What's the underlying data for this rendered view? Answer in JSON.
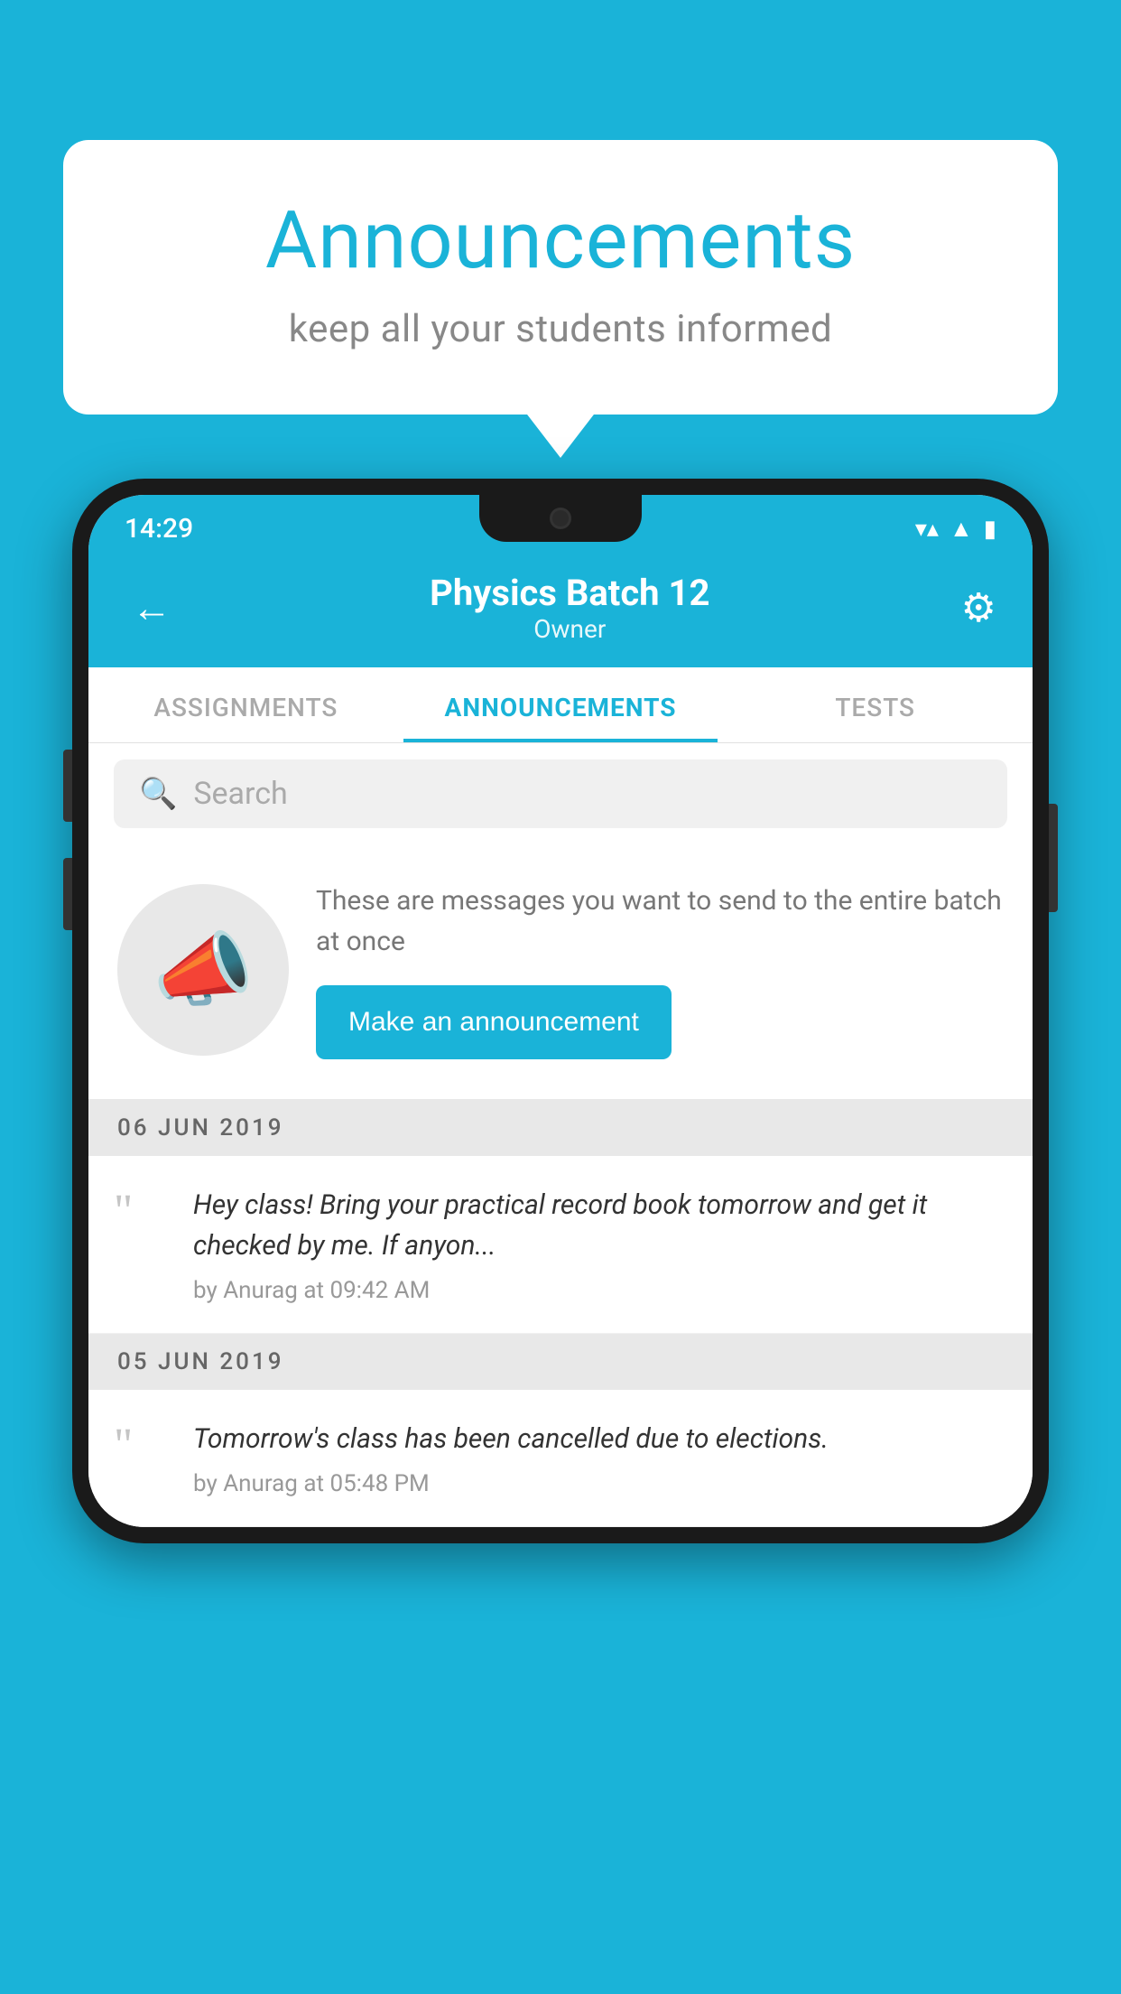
{
  "background_color": "#1ab3d8",
  "bubble": {
    "title": "Announcements",
    "subtitle": "keep all your students informed"
  },
  "phone": {
    "status_bar": {
      "time": "14:29",
      "icons": [
        "wifi",
        "signal",
        "battery"
      ]
    },
    "header": {
      "title": "Physics Batch 12",
      "subtitle": "Owner",
      "back_label": "←",
      "settings_label": "⚙"
    },
    "tabs": [
      {
        "label": "ASSIGNMENTS",
        "active": false
      },
      {
        "label": "ANNOUNCEMENTS",
        "active": true
      },
      {
        "label": "TESTS",
        "active": false
      }
    ],
    "search": {
      "placeholder": "Search"
    },
    "promo": {
      "description": "These are messages you want to send to the entire batch at once",
      "button_label": "Make an announcement"
    },
    "announcements": [
      {
        "date": "06  JUN  2019",
        "text": "Hey class! Bring your practical record book tomorrow and get it checked by me. If anyon...",
        "meta": "by Anurag at 09:42 AM"
      },
      {
        "date": "05  JUN  2019",
        "text": "Tomorrow's class has been cancelled due to elections.",
        "meta": "by Anurag at 05:48 PM"
      }
    ]
  }
}
